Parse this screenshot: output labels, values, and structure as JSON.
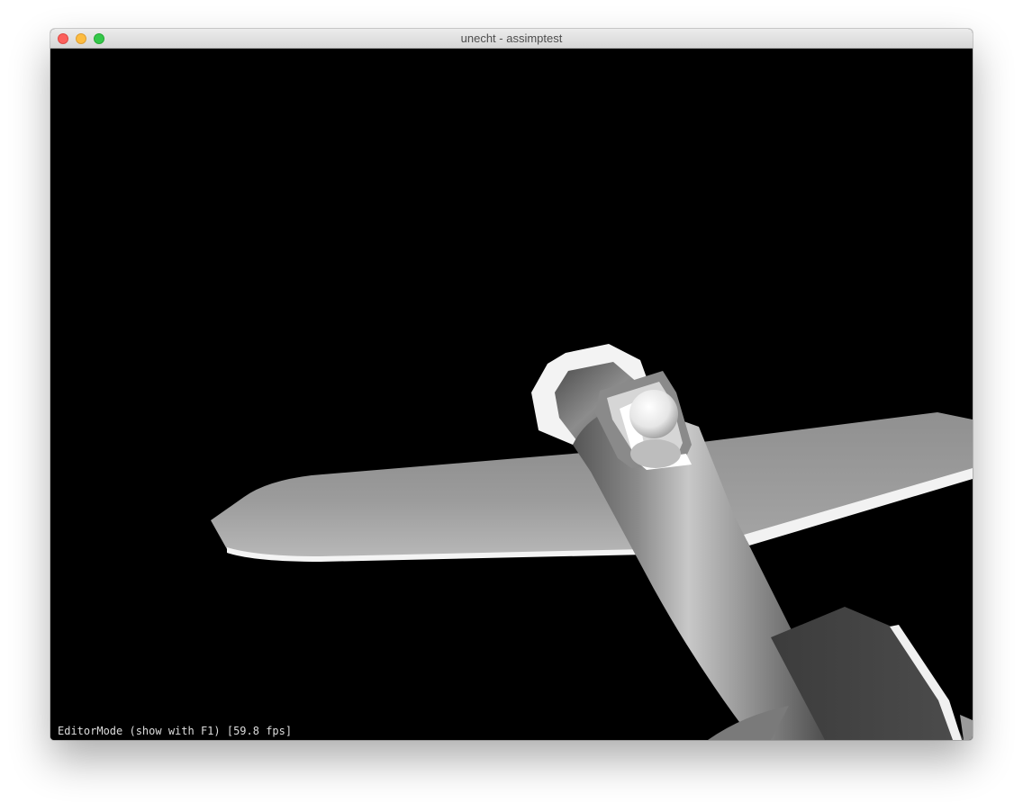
{
  "window": {
    "title": "unecht - assimptest"
  },
  "viewport": {
    "background_color": "#000000",
    "status_text": "EditorMode (show with F1) [59.8 fps]"
  },
  "controls": {
    "close_icon": "close-icon",
    "minimize_icon": "minimize-icon",
    "zoom_icon": "zoom-icon"
  }
}
